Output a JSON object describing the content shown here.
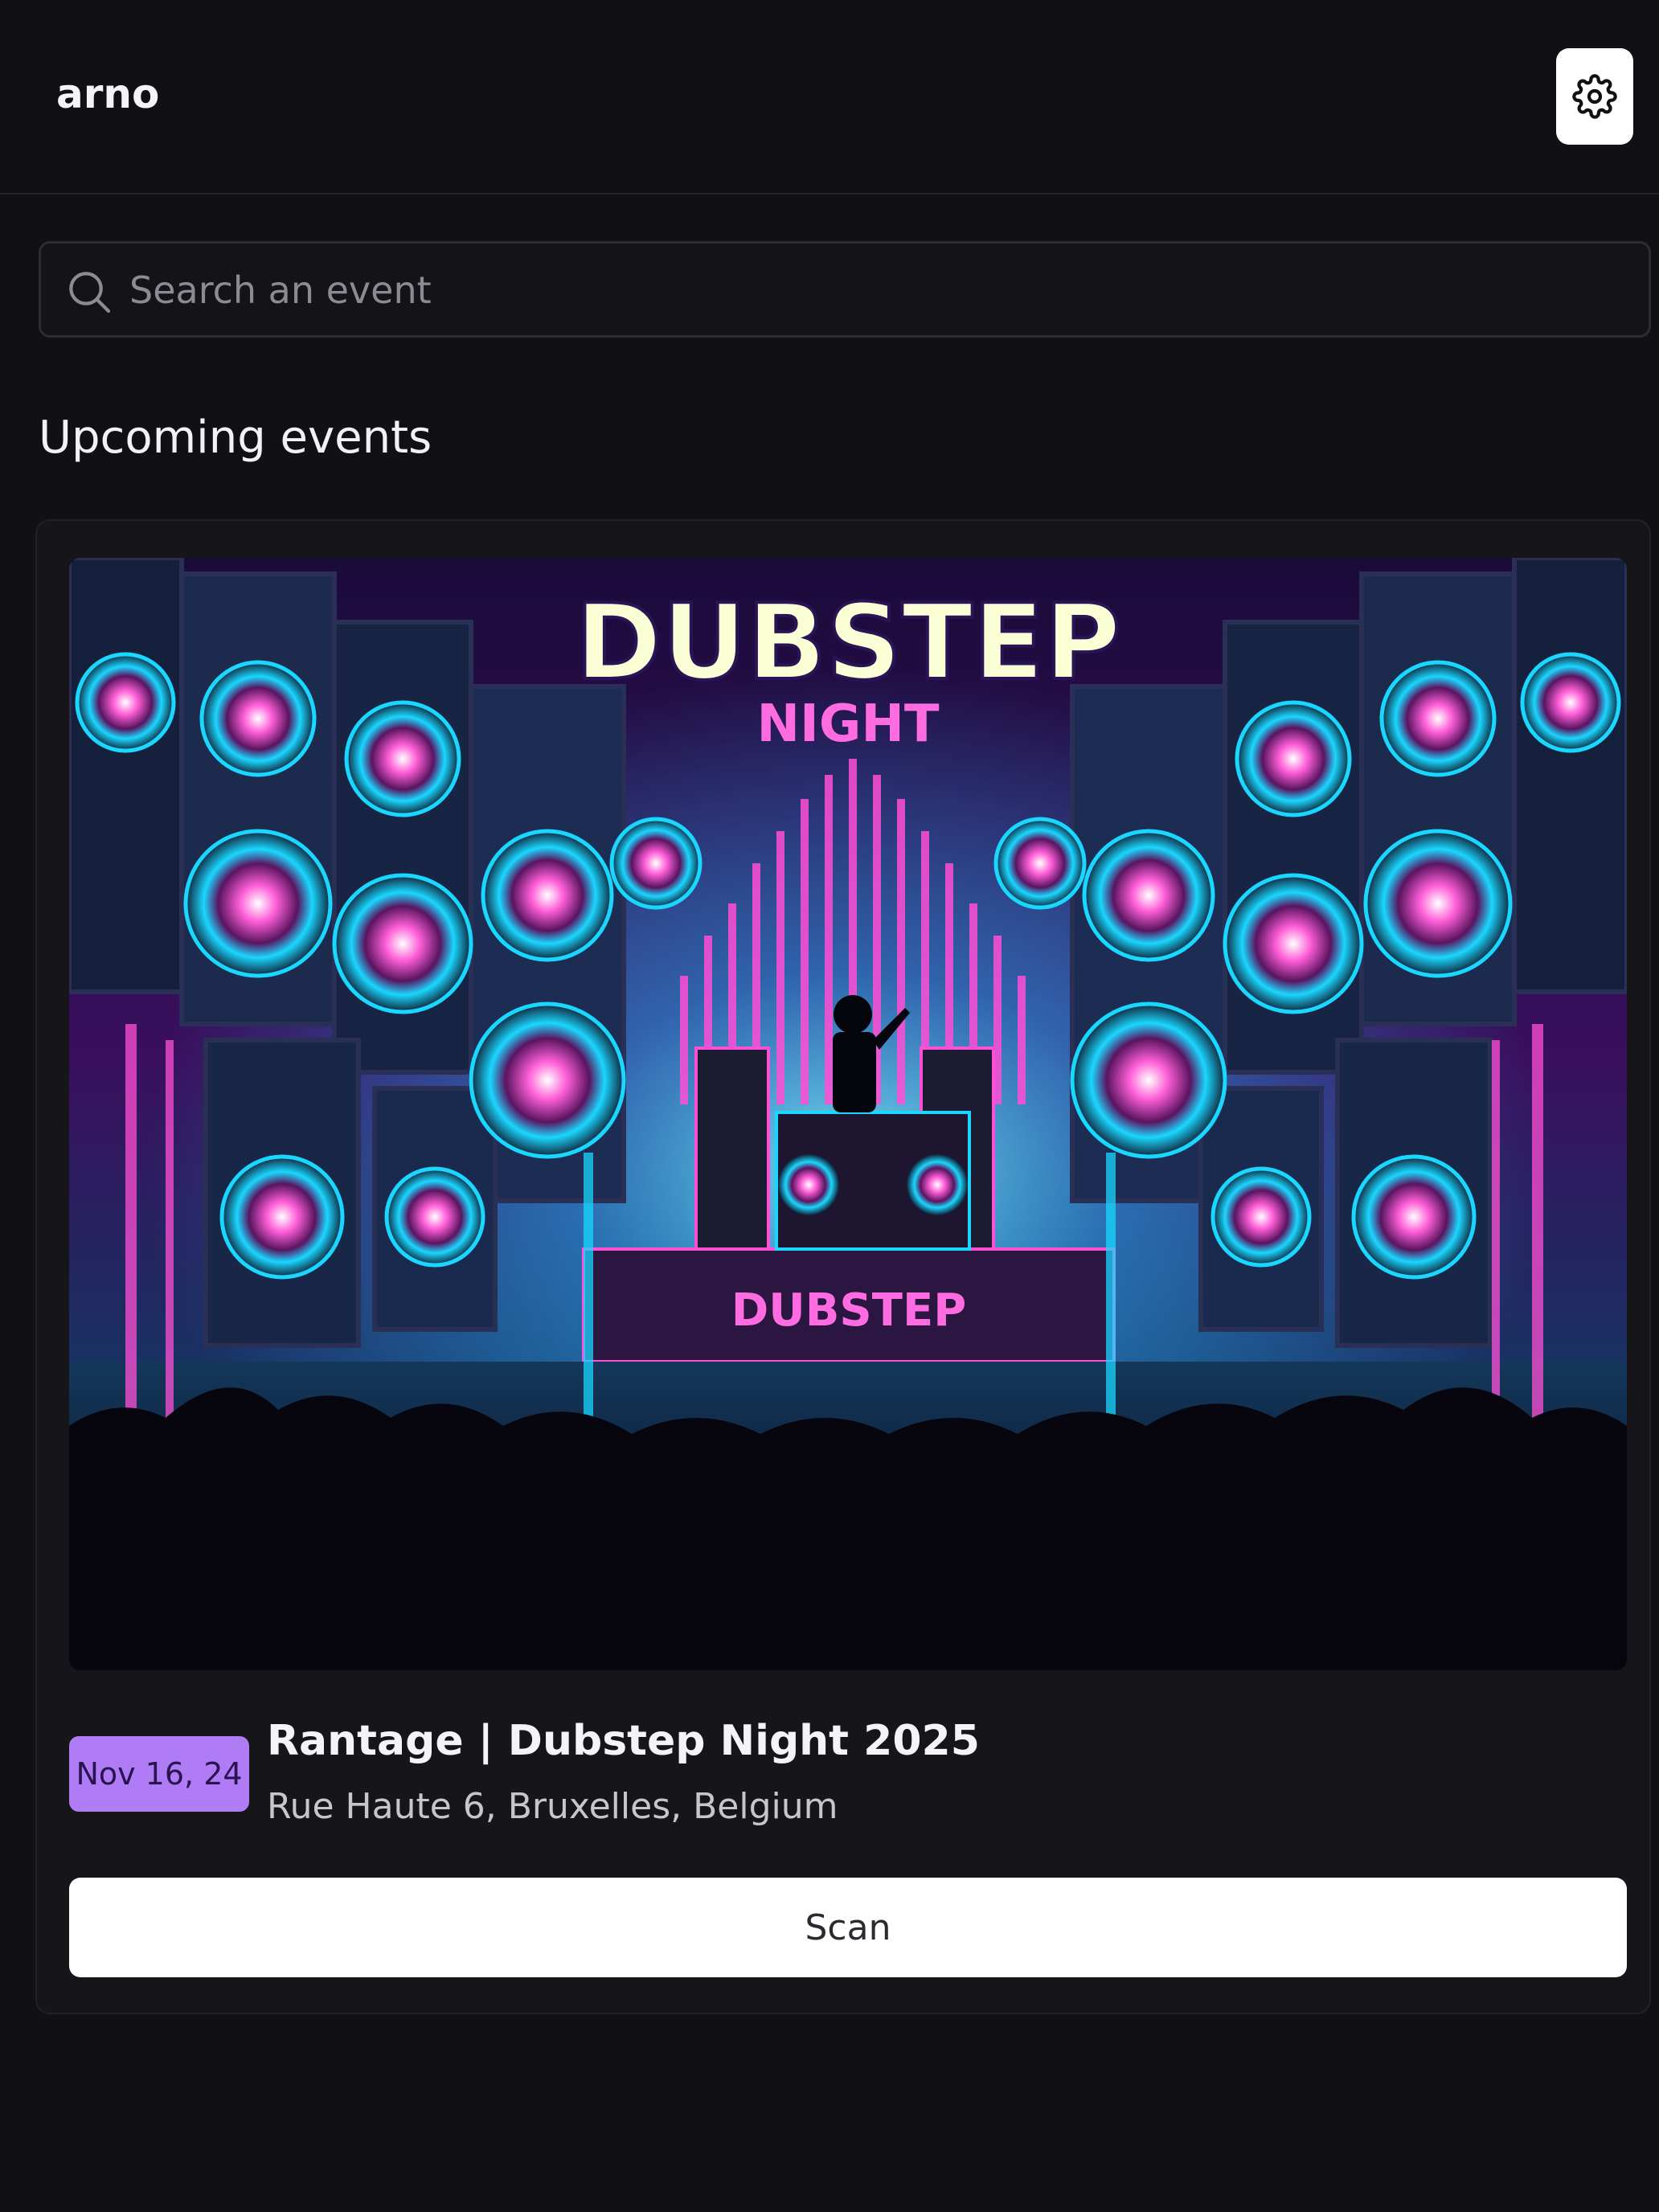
{
  "header": {
    "username": "arno",
    "settings_icon": "gear-icon"
  },
  "search": {
    "placeholder": "Search an event",
    "icon": "search-icon"
  },
  "section": {
    "title": "Upcoming events"
  },
  "event": {
    "image_alt": "Dubstep Night",
    "image_text_main": "DUBSTEP",
    "image_text_sub": "NIGHT",
    "image_stage_text": "DUBSTEP",
    "date": "Nov 16, 24",
    "title": "Rantage | Dubstep Night 2025",
    "location": "Rue Haute 6, Bruxelles, Belgium",
    "scan_label": "Scan"
  },
  "colors": {
    "background": "#111014",
    "card": "#161519",
    "date_badge": "#b07cf5",
    "button": "#ffffff",
    "neon_pink": "#ff3fd0",
    "neon_cyan": "#28e6ff"
  }
}
